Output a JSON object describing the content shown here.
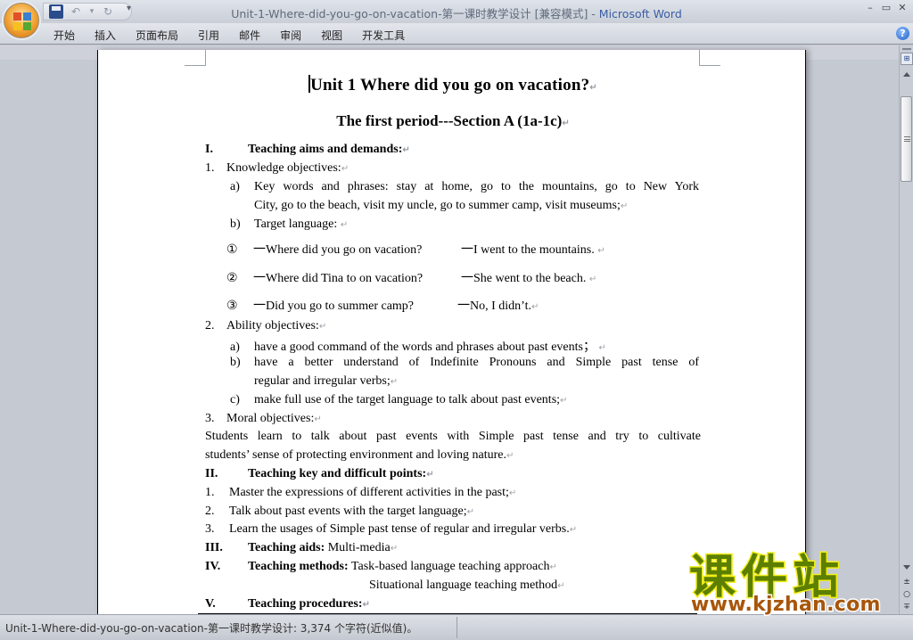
{
  "window": {
    "title_doc": "Unit-1-Where-did-you-go-on-vacation-第一课时教学设计 [兼容模式]",
    "title_sep": " - ",
    "title_app": "Microsoft Word",
    "controls": {
      "minimize": "–",
      "restore": "▭",
      "close": "✕"
    }
  },
  "qat": {
    "save": "save-icon",
    "undo": "↶",
    "undo_drop": "▾",
    "redo": "↻",
    "customize": "▾"
  },
  "ribbon": {
    "tabs": [
      "开始",
      "插入",
      "页面布局",
      "引用",
      "邮件",
      "审阅",
      "视图",
      "开发工具"
    ],
    "help": "?"
  },
  "document": {
    "title": "Unit 1 Where did you go on vacation?",
    "subtitle": "The first period---Section A (1a-1c)",
    "para_mark": "↵",
    "lines": [
      {
        "num": "I.",
        "text": "Teaching aims and demands:"
      },
      {
        "num": "1.",
        "text": "Knowledge objectives:"
      },
      {
        "num": "a)",
        "text": "Key words and phrases: stay at home, go to the mountains, go to New York"
      },
      {
        "num": "",
        "text": "City, go to the beach, visit my uncle, go to summer camp, visit museums;"
      },
      {
        "num": "b)",
        "text": "Target language: "
      },
      {
        "num": "①",
        "q": "一Where did you go on vacation?",
        "a": "一I went to the mountains."
      },
      {
        "num": "②",
        "q": "一Where did Tina to on vacation?",
        "a": "一She went to the beach."
      },
      {
        "num": "③",
        "q": "一Did you go to summer camp?",
        "a": "一No, I didn’t."
      },
      {
        "num": "2.",
        "text": "Ability objectives:"
      },
      {
        "num": "a)",
        "text": "have a good command of the words and phrases about past events；"
      },
      {
        "num": "b)",
        "text": "have a better understand of Indefinite Pronouns and Simple past tense of"
      },
      {
        "num": "",
        "text": "regular and irregular  verbs;"
      },
      {
        "num": "c)",
        "text": "make full use of the target language to talk about past events;"
      },
      {
        "num": "3.",
        "text": "Moral objectives:"
      },
      {
        "num": "",
        "text": "Students learn to talk about past events with Simple past tense and try to cultivate"
      },
      {
        "num": "",
        "text": "students’ sense of protecting environment and loving nature."
      },
      {
        "num": "II.",
        "text": "Teaching key and difficult points:"
      },
      {
        "num": "1.",
        "text": "Master the expressions  of different activities in the past;"
      },
      {
        "num": "2.",
        "text": "Talk about past events with the target language;"
      },
      {
        "num": "3.",
        "text": "Learn the usages of Simple past tense of regular and irregular verbs."
      },
      {
        "num": "III.",
        "label": "Teaching aids:",
        "text": " Multi-media"
      },
      {
        "num": "IV.",
        "label": "Teaching methods:",
        "text": " Task-based language teaching approach"
      },
      {
        "num": "",
        "text": "Situational language teaching method"
      },
      {
        "num": "V.",
        "text": "Teaching procedures:"
      }
    ]
  },
  "statusbar": {
    "text": "Unit-1-Where-did-you-go-on-vacation-第一课时教学设计: 3,374 个字符(近似值)。"
  },
  "scrollbar": {
    "ruler_icon": "view-ruler-icon",
    "prev_page": "±",
    "select_browse": "○",
    "next_page": "∓"
  },
  "watermark": {
    "cn": "课件站",
    "url": "www.kjzhan.com"
  }
}
